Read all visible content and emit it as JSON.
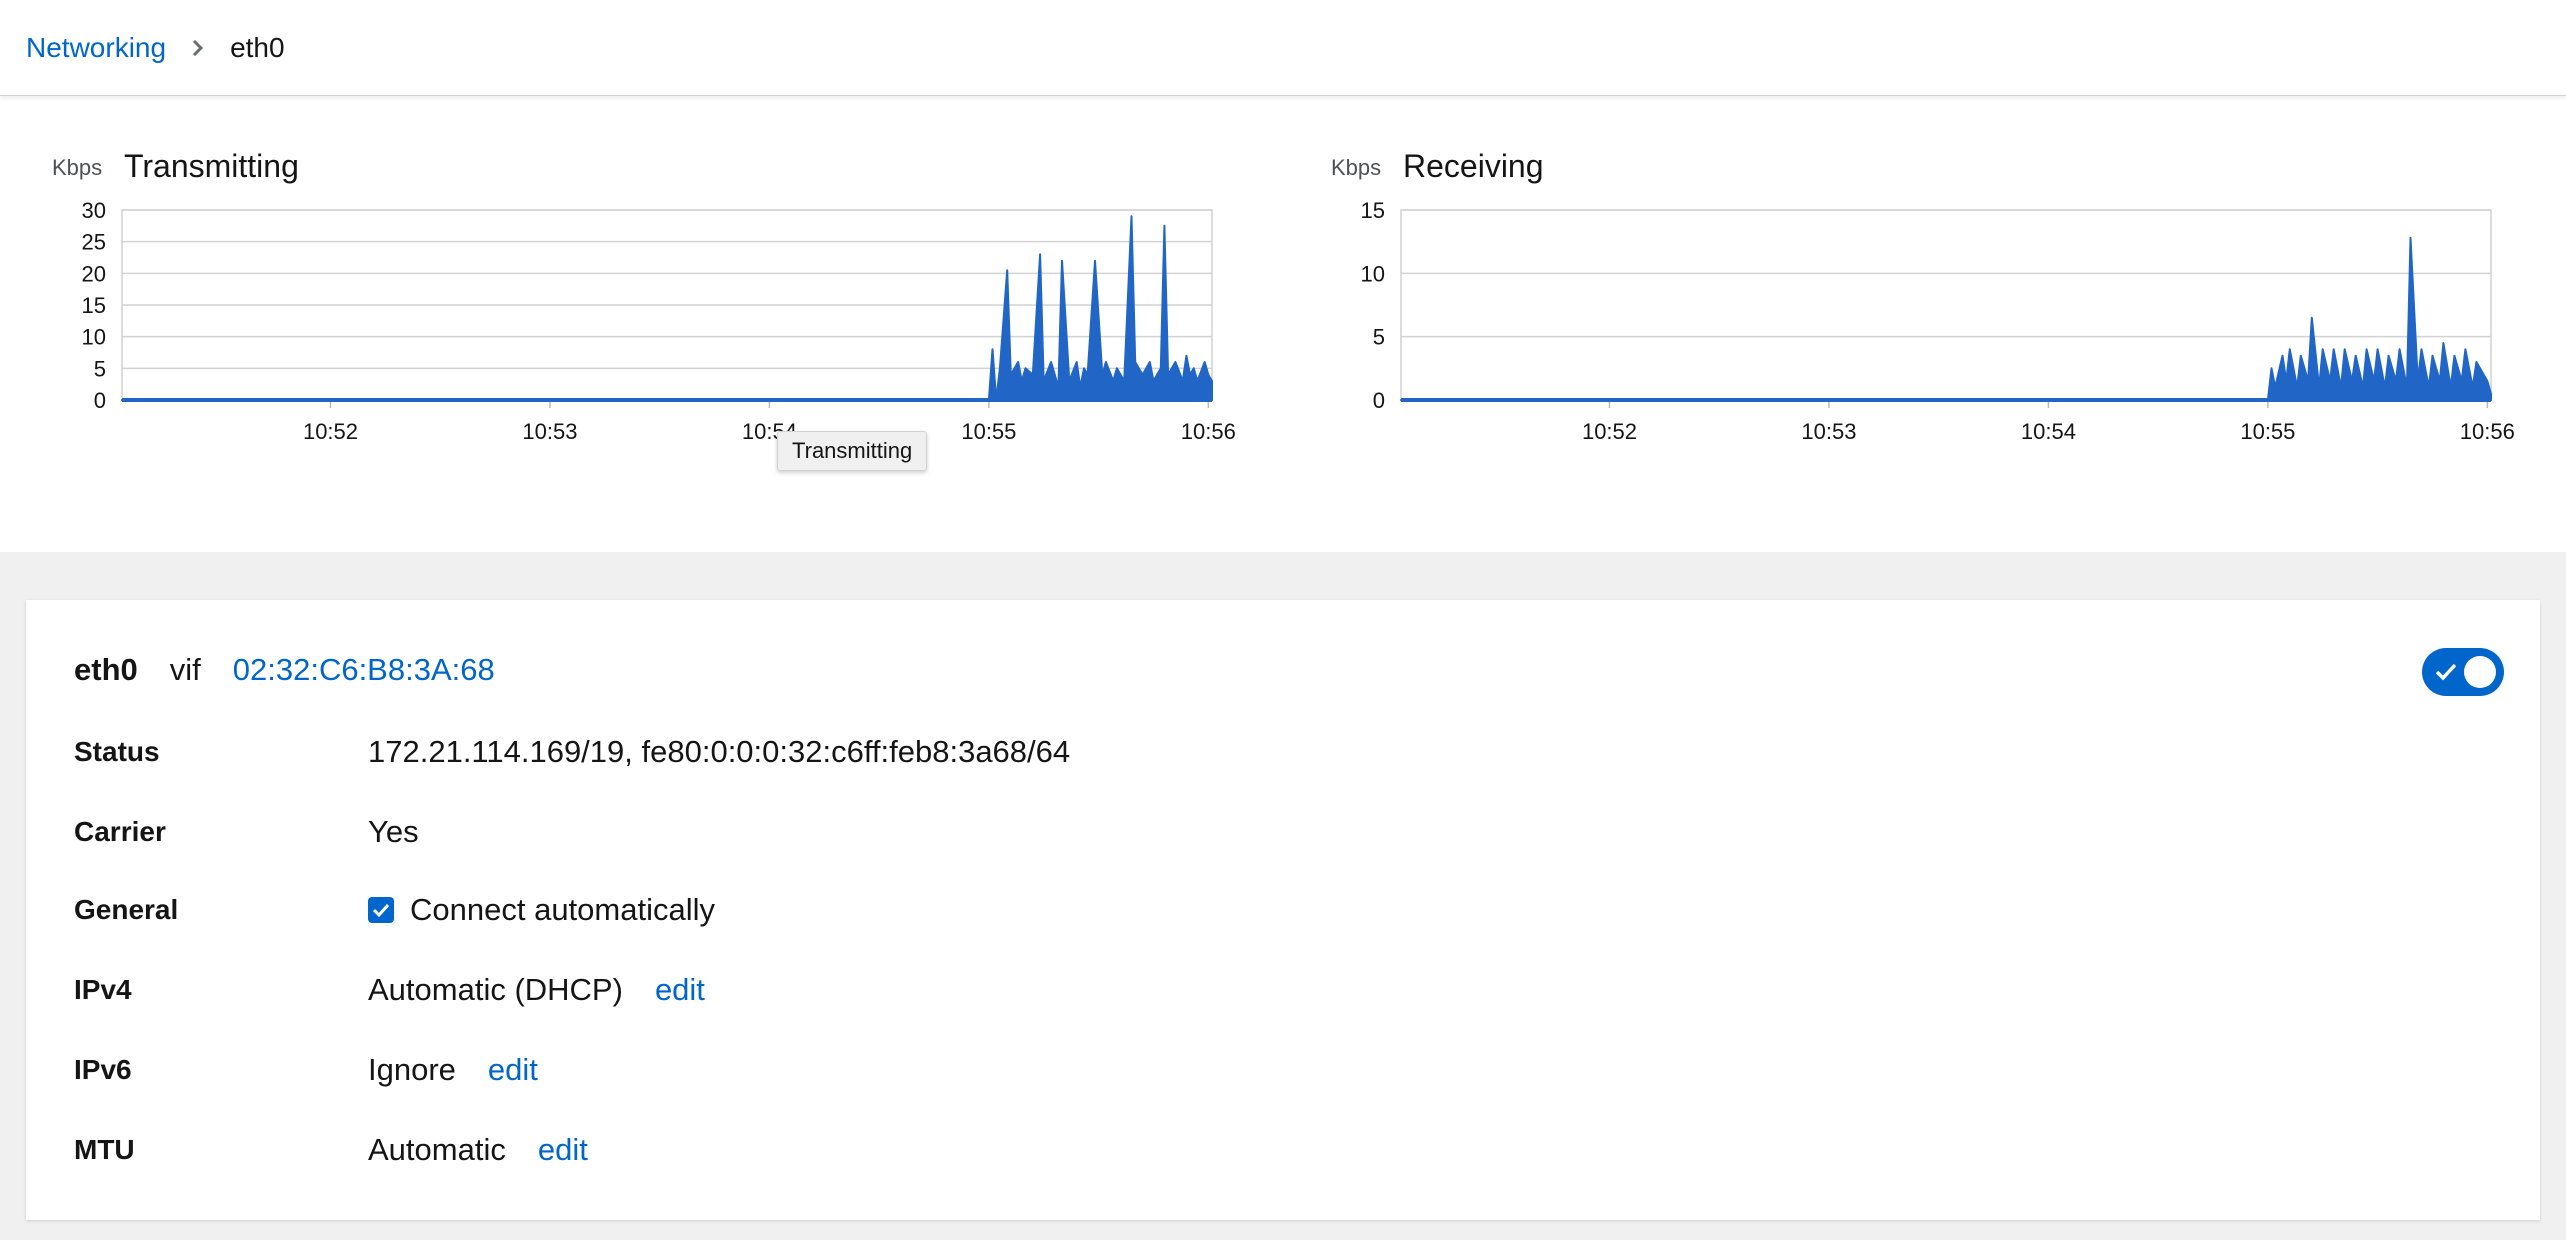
{
  "breadcrumb": {
    "parent": "Networking",
    "current": "eth0",
    "separator_icon": "chevron-right-icon"
  },
  "tooltip": {
    "text": "Transmitting"
  },
  "chart_data": [
    {
      "type": "area",
      "title": "Transmitting",
      "ylabel": "Kbps",
      "xlabel": "",
      "ylim": [
        0,
        30
      ],
      "yticks": [
        "0",
        "5",
        "10",
        "15",
        "20",
        "25",
        "30"
      ],
      "xticks": [
        "10:52",
        "10:53",
        "10:54",
        "10:55",
        "10:56"
      ],
      "grid": true,
      "color": "#2166c7",
      "series": [
        {
          "x": [
            "10:51:03",
            "10:55:00",
            "10:55:01",
            "10:55:02",
            "10:55:03",
            "10:55:05",
            "10:55:06",
            "10:55:08",
            "10:55:09",
            "10:55:10",
            "10:55:12",
            "10:55:14",
            "10:55:15",
            "10:55:17",
            "10:55:19",
            "10:55:20",
            "10:55:22",
            "10:55:24",
            "10:55:25",
            "10:55:26",
            "10:55:27",
            "10:55:29",
            "10:55:31",
            "10:55:32",
            "10:55:34",
            "10:55:35",
            "10:55:37",
            "10:55:39",
            "10:55:40",
            "10:55:42",
            "10:55:44",
            "10:55:45",
            "10:55:47",
            "10:55:48",
            "10:55:49",
            "10:55:51",
            "10:55:53",
            "10:55:54",
            "10:55:55",
            "10:55:56",
            "10:55:57",
            "10:55:59",
            "10:56:00",
            "10:56:01"
          ],
          "values": [
            0,
            0,
            8,
            0,
            5,
            20.5,
            4,
            6,
            3,
            5,
            4,
            23,
            3,
            6,
            2,
            22,
            3,
            6,
            2,
            5,
            4,
            22,
            4,
            6,
            3,
            5,
            3,
            29,
            6,
            4,
            6,
            3,
            5,
            27.5,
            4,
            6,
            3,
            7,
            4,
            5,
            3,
            6,
            4,
            3
          ]
        }
      ]
    },
    {
      "type": "area",
      "title": "Receiving",
      "ylabel": "Kbps",
      "xlabel": "",
      "ylim": [
        0,
        15
      ],
      "yticks": [
        "0",
        "5",
        "10",
        "15"
      ],
      "xticks": [
        "10:52",
        "10:53",
        "10:54",
        "10:55",
        "10:56"
      ],
      "grid": true,
      "color": "#2166c7",
      "series": [
        {
          "x": [
            "10:51:03",
            "10:55:00",
            "10:55:01",
            "10:55:02",
            "10:55:04",
            "10:55:05",
            "10:55:06",
            "10:55:08",
            "10:55:09",
            "10:55:11",
            "10:55:12",
            "10:55:14",
            "10:55:15",
            "10:55:17",
            "10:55:18",
            "10:55:20",
            "10:55:21",
            "10:55:23",
            "10:55:24",
            "10:55:26",
            "10:55:27",
            "10:55:29",
            "10:55:30",
            "10:55:32",
            "10:55:33",
            "10:55:35",
            "10:55:36",
            "10:55:38",
            "10:55:39",
            "10:55:41",
            "10:55:42",
            "10:55:44",
            "10:55:45",
            "10:55:47",
            "10:55:48",
            "10:55:50",
            "10:55:51",
            "10:55:53",
            "10:55:54",
            "10:55:56",
            "10:55:57",
            "10:55:59",
            "10:56:00",
            "10:56:01"
          ],
          "values": [
            0,
            0,
            2.5,
            1,
            3.5,
            1.5,
            4,
            1,
            3.5,
            1.5,
            6.5,
            1,
            4,
            1.5,
            4,
            1,
            4,
            1.5,
            3.5,
            1,
            4,
            1.5,
            4,
            1,
            3.5,
            1.5,
            4,
            1,
            12.8,
            1.5,
            4,
            1,
            3.5,
            1.5,
            4.5,
            1,
            3.5,
            1.5,
            4,
            1,
            3,
            2,
            1.5,
            0.5
          ]
        }
      ]
    }
  ],
  "interface": {
    "name": "eth0",
    "type": "vif",
    "mac": "02:32:C6:B8:3A:68",
    "enabled": true,
    "toggle_icon": "check-icon"
  },
  "details": {
    "status": {
      "label": "Status",
      "value": "172.21.114.169/19, fe80:0:0:0:32:c6ff:feb8:3a68/64"
    },
    "carrier": {
      "label": "Carrier",
      "value": "Yes"
    },
    "general": {
      "label": "General",
      "value": "Connect automatically",
      "checked": true
    },
    "ipv4": {
      "label": "IPv4",
      "value": "Automatic (DHCP)",
      "edit": "edit"
    },
    "ipv6": {
      "label": "IPv6",
      "value": "Ignore",
      "edit": "edit"
    },
    "mtu": {
      "label": "MTU",
      "value": "Automatic",
      "edit": "edit"
    }
  }
}
